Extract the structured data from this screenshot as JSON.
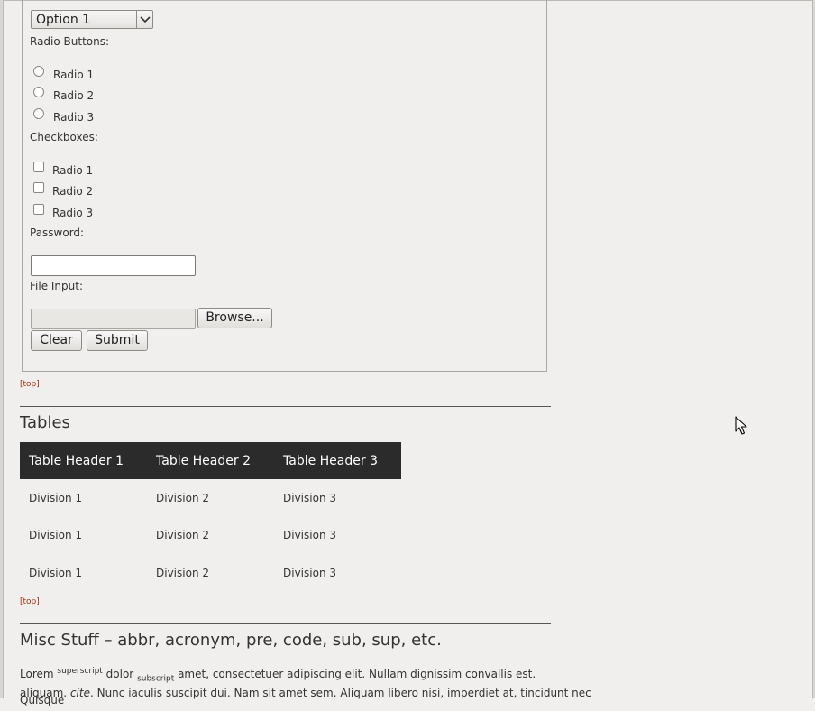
{
  "form": {
    "select_value": "Option 1",
    "radio_heading": "Radio Buttons:",
    "radios": [
      "Radio 1",
      "Radio 2",
      "Radio 3"
    ],
    "checkbox_heading": "Checkboxes:",
    "checkboxes": [
      "Radio 1",
      "Radio 2",
      "Radio 3"
    ],
    "password_label": "Password:",
    "password_value": "",
    "file_label": "File Input:",
    "browse_label": "Browse...",
    "clear_label": "Clear",
    "submit_label": "Submit"
  },
  "top_link": "[top]",
  "tables_section": {
    "heading": "Tables",
    "headers": [
      "Table Header 1",
      "Table Header 2",
      "Table Header 3"
    ],
    "rows": [
      [
        "Division 1",
        "Division 2",
        "Division 3"
      ],
      [
        "Division 1",
        "Division 2",
        "Division 3"
      ],
      [
        "Division 1",
        "Division 2",
        "Division 3"
      ]
    ]
  },
  "misc_section": {
    "heading": "Misc Stuff – abbr, acronym, pre, code, sub, sup, etc.",
    "p_lorem": "Lorem",
    "p_sup": "superscript",
    "p_dolor": "dolor",
    "p_sub": "subscript",
    "p_rest": "amet, consectetuer adipiscing elit. Nullam dignissim convallis est. Quisque",
    "p_line2_a": "aliquam.",
    "p_cite": "cite",
    "p_line2_b": ". Nunc iaculis suscipit dui. Nam sit amet sem. Aliquam libero nisi, imperdiet at, tincidunt nec"
  },
  "icons": {
    "select_arrow": "chevron-down-icon",
    "cursor": "mouse-pointer-icon"
  }
}
